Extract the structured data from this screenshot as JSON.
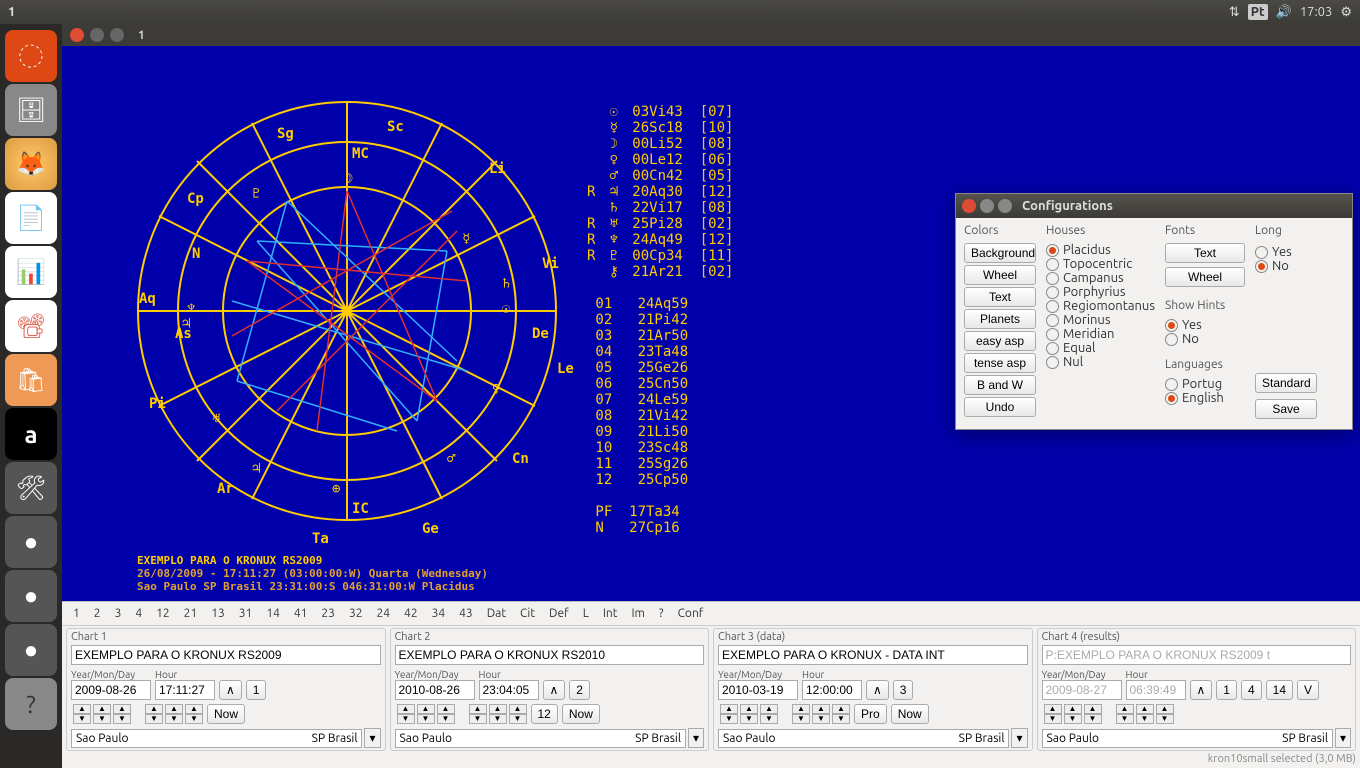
{
  "topbar": {
    "title": "1",
    "time": "17:03",
    "kb": "Pt"
  },
  "apptitle": "1",
  "chart_data": {
    "type": "table",
    "positions": [
      {
        "sym": "☉",
        "deg": "03Vi43",
        "house": "07"
      },
      {
        "sym": "☿",
        "deg": "26Sc18",
        "house": "10"
      },
      {
        "sym": "☽",
        "deg": "00Li52",
        "house": "08"
      },
      {
        "sym": "♀",
        "deg": "00Le12",
        "house": "06"
      },
      {
        "sym": "♂",
        "deg": "00Cn42",
        "house": "05"
      },
      {
        "sym": "♃",
        "deg": "20Aq30",
        "house": "12",
        "retro": "R"
      },
      {
        "sym": "♄",
        "deg": "22Vi17",
        "house": "08"
      },
      {
        "sym": "♅",
        "deg": "25Pi28",
        "house": "02",
        "retro": "R"
      },
      {
        "sym": "♆",
        "deg": "24Aq49",
        "house": "12",
        "retro": "R"
      },
      {
        "sym": "♇",
        "deg": "00Cp34",
        "house": "11",
        "retro": "R"
      },
      {
        "sym": "⚷",
        "deg": "21Ar21",
        "house": "02"
      }
    ],
    "houses": [
      {
        "n": "01",
        "cusp": "24Aq59"
      },
      {
        "n": "02",
        "cusp": "21Pi42"
      },
      {
        "n": "03",
        "cusp": "21Ar50"
      },
      {
        "n": "04",
        "cusp": "23Ta48"
      },
      {
        "n": "05",
        "cusp": "25Ge26"
      },
      {
        "n": "06",
        "cusp": "25Cn50"
      },
      {
        "n": "07",
        "cusp": "24Le59"
      },
      {
        "n": "08",
        "cusp": "21Vi42"
      },
      {
        "n": "09",
        "cusp": "21Li50"
      },
      {
        "n": "10",
        "cusp": "23Sc48"
      },
      {
        "n": "11",
        "cusp": "25Sg26"
      },
      {
        "n": "12",
        "cusp": "25Cp50"
      }
    ],
    "extras": [
      {
        "lbl": "PF",
        "val": "17Ta34"
      },
      {
        "lbl": "N",
        "val": "27Cp16"
      }
    ],
    "signs": [
      "Sc",
      "Li",
      "Vi",
      "Le",
      "Cn",
      "Ge",
      "Ta",
      "Ar",
      "Pi",
      "Aq",
      "Cp",
      "Sg"
    ],
    "axes": {
      "asc": "As",
      "mc": "MC",
      "dsc": "De",
      "ic": "IC",
      "n": "N"
    }
  },
  "footer": {
    "l1": "EXEMPLO PARA O KRONUX RS2009",
    "l2": "26/08/2009 - 17:11:27  (03:00:00:W)  Quarta  (Wednesday)",
    "l3": "Sao Paulo SP Brasil 23:31:00:S  046:31:00:W  Placidus"
  },
  "tabs": [
    "1",
    "2",
    "3",
    "4",
    "12",
    "21",
    "13",
    "31",
    "14",
    "41",
    "23",
    "32",
    "24",
    "42",
    "34",
    "43",
    "Dat",
    "Cit",
    "Def",
    "L",
    "Int",
    "Im",
    "?",
    "Conf"
  ],
  "charts": [
    {
      "title": "Chart 1",
      "name": "EXEMPLO PARA O KRONUX RS2009",
      "date": "2009-08-26",
      "time": "17:11:27",
      "btnA": "∧",
      "btnB": "1",
      "btnNow": "Now",
      "city": "Sao Paulo",
      "region": "SP Brasil"
    },
    {
      "title": "Chart 2",
      "name": "EXEMPLO PARA O KRONUX RS2010",
      "date": "2010-08-26",
      "time": "23:04:05",
      "btnA": "∧",
      "btnB": "2",
      "btnC": "12",
      "btnNow": "Now",
      "city": "Sao Paulo",
      "region": "SP Brasil"
    },
    {
      "title": "Chart 3 (data)",
      "name": "EXEMPLO PARA O KRONUX - DATA INT",
      "date": "2010-03-19",
      "time": "12:00:00",
      "btnA": "∧",
      "btnB": "3",
      "btnPro": "Pro",
      "btnNow": "Now",
      "city": "Sao Paulo",
      "region": "SP Brasil"
    },
    {
      "title": "Chart 4 (results)",
      "name": "P:EXEMPLO PARA O KRONUX RS2009 t",
      "date": "2009-08-27",
      "time": "06:39:49",
      "btnA": "∧",
      "btns": [
        "1",
        "4",
        "14"
      ],
      "btnV": "V",
      "city": "Sao Paulo",
      "region": "SP Brasil",
      "disabled": true
    }
  ],
  "cfg": {
    "title": "Configurations",
    "colors": {
      "hd": "Colors",
      "btns": [
        "Background",
        "Wheel",
        "Text",
        "Planets",
        "easy asp",
        "tense asp",
        "B and W",
        "Undo"
      ]
    },
    "houses": {
      "hd": "Houses",
      "opts": [
        "Placidus",
        "Topocentric",
        "Campanus",
        "Porphyrius",
        "Regiomontanus",
        "Morinus",
        "Meridian",
        "Equal",
        "Nul"
      ],
      "sel": "Placidus"
    },
    "fonts": {
      "hd": "Fonts",
      "btns": [
        "Text",
        "Wheel"
      ]
    },
    "long": {
      "hd": "Long",
      "opts": [
        "Yes",
        "No"
      ],
      "sel": "No"
    },
    "hints": {
      "hd": "Show Hints",
      "opts": [
        "Yes",
        "No"
      ],
      "sel": "Yes"
    },
    "lang": {
      "hd": "Languages",
      "opts": [
        "Portug",
        "English"
      ],
      "sel": "English"
    },
    "rt": [
      "Standard",
      "Save"
    ]
  },
  "ymlbl": "Year/Mon/Day",
  "hrlbl": "Hour",
  "status": "kron10small  selected (3,0 MB)"
}
